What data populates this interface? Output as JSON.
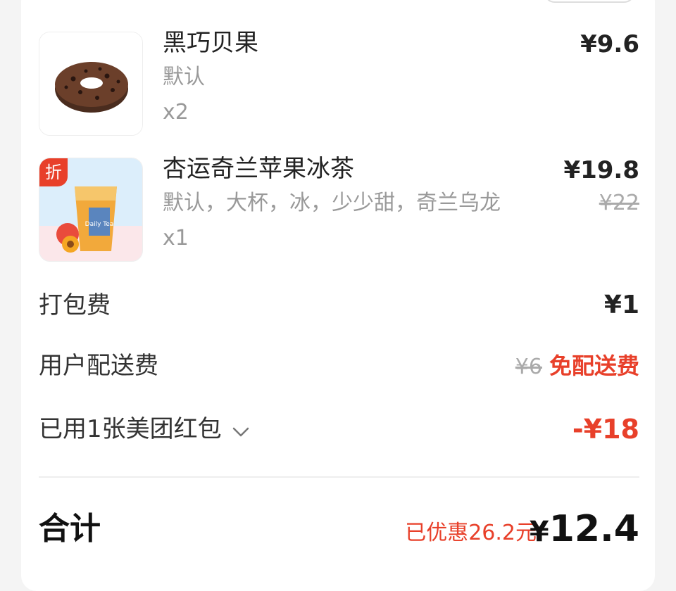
{
  "items": [
    {
      "name": "黑巧贝果",
      "spec": "默认",
      "qty": "x2",
      "price": "¥9.6",
      "original_price": "",
      "image": "chocolate-bagel-image"
    },
    {
      "name": "杏运奇兰苹果冰茶",
      "spec": "默认，大杯，冰，少少甜，奇兰乌龙",
      "qty": "x1",
      "price": "¥19.8",
      "original_price": "¥22",
      "badge": "折",
      "image": "apple-iced-tea-image",
      "image_text": "Daily Tea"
    }
  ],
  "fees": {
    "packing_label": "打包费",
    "packing_value": "¥1",
    "delivery_label": "用户配送费",
    "delivery_original": "¥6",
    "delivery_value": "免配送费",
    "redpacket_label": "已用1张美团红包",
    "redpacket_value": "-¥18"
  },
  "total": {
    "label": "合计",
    "saved": "已优惠26.2元",
    "currency": "¥",
    "amount": "12.4"
  },
  "colors": {
    "accent_red": "#e8402a",
    "text_primary": "#222222",
    "text_secondary": "#999999"
  }
}
